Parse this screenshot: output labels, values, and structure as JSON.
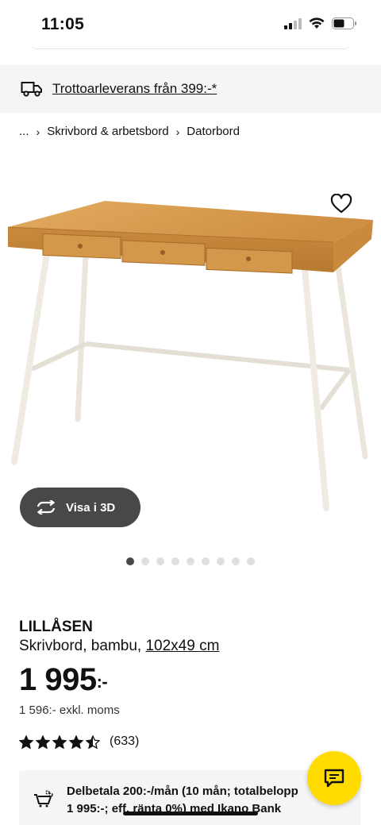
{
  "status": {
    "time": "11:05"
  },
  "delivery": {
    "text": "Trottoarleverans från 399:-*"
  },
  "breadcrumb": {
    "ellipsis": "...",
    "items": [
      "Skrivbord & arbetsbord",
      "Datorbord"
    ]
  },
  "image_carousel": {
    "slide_count": 9,
    "active_index": 0
  },
  "view3d": {
    "label": "Visa i 3D"
  },
  "product": {
    "name": "LILLÅSEN",
    "description": "Skrivbord, bambu,",
    "size": "102x49 cm",
    "price_main": "1 995",
    "price_suffix": ":-",
    "price_ex_vat": "1 596:- exkl. moms",
    "rating": 4.5,
    "rating_max": 5,
    "review_count": "(633)"
  },
  "finance": {
    "line1": "Delbetala 200:-/mån (10 mån; totalbelopp",
    "line2": "1 995:-; eff. ränta 0%) med Ikano Bank"
  },
  "colors": {
    "chat_button": "#ffdb00",
    "dark_button": "#484848",
    "panel": "#f5f5f5"
  },
  "icons": {
    "truck": "truck-icon",
    "heart": "heart-icon",
    "rotate": "rotate-3d-icon",
    "chat": "chat-icon",
    "finance": "cart-coins-icon"
  }
}
